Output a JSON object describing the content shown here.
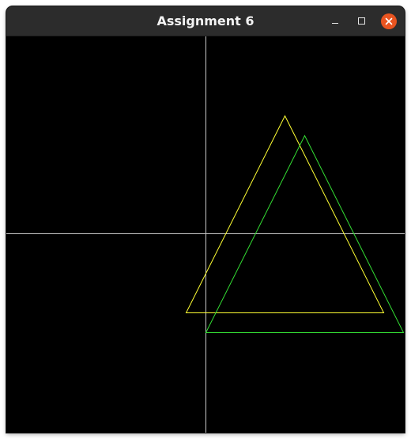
{
  "window": {
    "title": "Assignment 6"
  },
  "controls": {
    "minimize_icon": "minimize-icon",
    "maximize_icon": "maximize-icon",
    "close_icon": "close-icon",
    "close_color": "#e95420"
  },
  "scene": {
    "background": "#000000",
    "axis_color": "#c8c8c8",
    "shapes": [
      {
        "name": "yellow-triangle",
        "color": "#ffff33"
      },
      {
        "name": "green-triangle",
        "color": "#33dd33"
      }
    ]
  }
}
